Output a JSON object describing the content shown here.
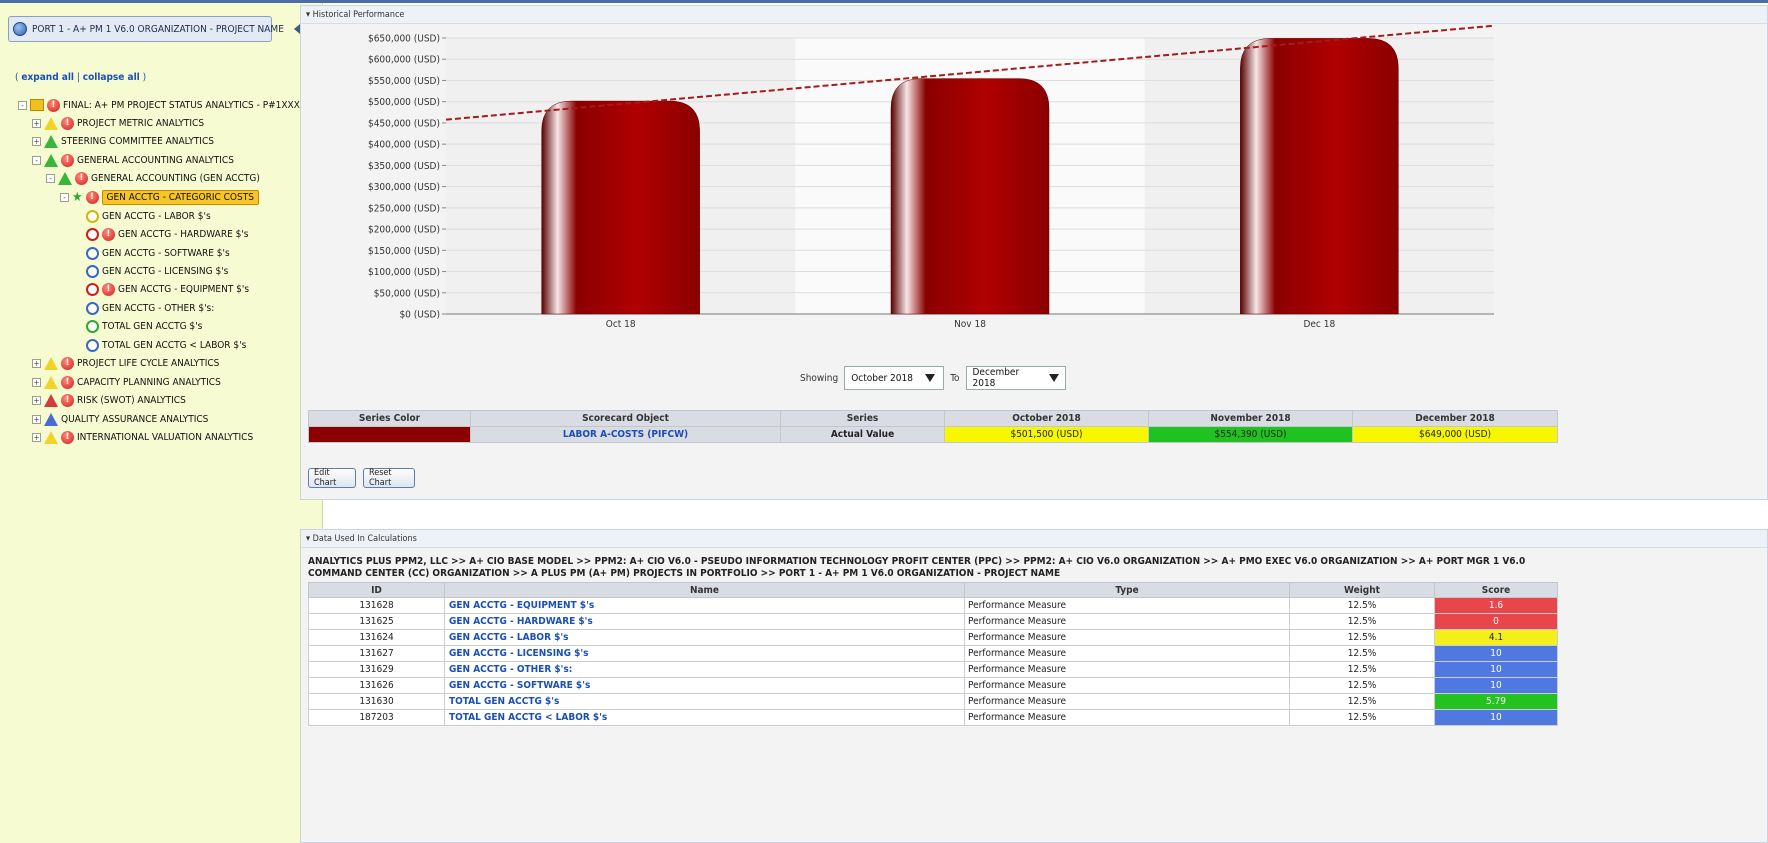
{
  "left_panel": {
    "org_title": "PORT 1 - A+ PM 1 V6.0 ORGANIZATION - PROJECT NAME",
    "expand_all": "expand all",
    "collapse_all": "collapse all",
    "tree": [
      {
        "label": "FINAL: A+ PM PROJECT STATUS ANALYTICS - P#1XXX"
      },
      {
        "label": "PROJECT METRIC ANALYTICS"
      },
      {
        "label": "STEERING COMMITTEE ANALYTICS"
      },
      {
        "label": "GENERAL ACCOUNTING ANALYTICS"
      },
      {
        "label": "GENERAL ACCOUNTING (GEN ACCTG)"
      },
      {
        "label": "GEN ACCTG - CATEGORIC COSTS"
      },
      {
        "label": "GEN ACCTG - LABOR $'s"
      },
      {
        "label": "GEN ACCTG - HARDWARE $'s"
      },
      {
        "label": "GEN ACCTG - SOFTWARE $'s"
      },
      {
        "label": "GEN ACCTG - LICENSING $'s"
      },
      {
        "label": "GEN ACCTG - EQUIPMENT $'s"
      },
      {
        "label": "GEN ACCTG - OTHER $'s:"
      },
      {
        "label": "TOTAL GEN ACCTG $'s"
      },
      {
        "label": "TOTAL GEN ACCTG < LABOR $'s"
      },
      {
        "label": "PROJECT LIFE CYCLE ANALYTICS"
      },
      {
        "label": "CAPACITY PLANNING ANALYTICS"
      },
      {
        "label": "RISK (SWOT) ANALYTICS"
      },
      {
        "label": "QUALITY ASSURANCE ANALYTICS"
      },
      {
        "label": "INTERNATIONAL VALUATION ANALYTICS"
      }
    ]
  },
  "historical": {
    "header": "Historical Performance",
    "showing_label": "Showing",
    "from_value": "October 2018",
    "to_label": "To",
    "to_value": "December 2018",
    "table_headers": [
      "Series Color",
      "Scorecard Object",
      "Series",
      "October 2018",
      "November 2018",
      "December 2018"
    ],
    "row": {
      "scorecard_object": "LABOR A-COSTS (PIFCW)",
      "series": "Actual Value",
      "oct": "$501,500 (USD)",
      "nov": "$554,390 (USD)",
      "dec": "$649,000 (USD)"
    },
    "edit_chart": "Edit Chart",
    "reset_chart": "Reset Chart"
  },
  "chart_data": {
    "type": "bar",
    "categories": [
      "Oct 18",
      "Nov 18",
      "Dec 18"
    ],
    "values": [
      501500,
      554390,
      649000
    ],
    "title": "",
    "xlabel": "",
    "ylabel": "",
    "ylim": [
      0,
      650000
    ],
    "ytick_values": [
      0,
      50000,
      100000,
      150000,
      200000,
      250000,
      300000,
      350000,
      400000,
      450000,
      500000,
      550000,
      600000,
      650000
    ],
    "ytick_labels": [
      "$0 (USD)",
      "$50,000 (USD)",
      "$100,000 (USD)",
      "$150,000 (USD)",
      "$200,000 (USD)",
      "$250,000 (USD)",
      "$300,000 (USD)",
      "$350,000 (USD)",
      "$400,000 (USD)",
      "$450,000 (USD)",
      "$500,000 (USD)",
      "$550,000 (USD)",
      "$600,000 (USD)",
      "$650,000 (USD)"
    ],
    "trendline": {
      "style": "dashed",
      "color": "#a61a1a"
    },
    "bar_color": "#8b0000",
    "grid": true,
    "legend": "none"
  },
  "calc": {
    "header": "Data Used In Calculations",
    "breadcrumb": "ANALYTICS PLUS PPM2, LLC  >>  A+ CIO BASE MODEL  >>  PPM2: A+ CIO V6.0 - PSEUDO INFORMATION TECHNOLOGY PROFIT CENTER (PPC)  >>  PPM2: A+ CIO V6.0 ORGANIZATION  >>  A+ PMO EXEC V6.0 ORGANIZATION  >>  A+ PORT MGR 1 V6.0 COMMAND CENTER (CC) ORGANIZATION  >>  A PLUS PM (A+ PM) PROJECTS IN PORTFOLIO  >>  PORT 1 - A+ PM 1 V6.0 ORGANIZATION - PROJECT NAME",
    "headers": [
      "ID",
      "Name",
      "Type",
      "Weight",
      "Score"
    ],
    "rows": [
      {
        "id": "131628",
        "name": "GEN ACCTG - EQUIPMENT $'s",
        "type": "Performance Measure",
        "weight": "12.5%",
        "score": "1.6",
        "color": "#e8464a"
      },
      {
        "id": "131625",
        "name": "GEN ACCTG - HARDWARE $'s",
        "type": "Performance Measure",
        "weight": "12.5%",
        "score": "0",
        "color": "#e8464a"
      },
      {
        "id": "131624",
        "name": "GEN ACCTG - LABOR $'s",
        "type": "Performance Measure",
        "weight": "12.5%",
        "score": "4.1",
        "color": "#f4ef1a"
      },
      {
        "id": "131627",
        "name": "GEN ACCTG - LICENSING $'s",
        "type": "Performance Measure",
        "weight": "12.5%",
        "score": "10",
        "color": "#4f79e0"
      },
      {
        "id": "131629",
        "name": "GEN ACCTG - OTHER $'s:",
        "type": "Performance Measure",
        "weight": "12.5%",
        "score": "10",
        "color": "#4f79e0"
      },
      {
        "id": "131626",
        "name": "GEN ACCTG - SOFTWARE $'s",
        "type": "Performance Measure",
        "weight": "12.5%",
        "score": "10",
        "color": "#4f79e0"
      },
      {
        "id": "131630",
        "name": "TOTAL GEN ACCTG $'s",
        "type": "Performance Measure",
        "weight": "12.5%",
        "score": "5.79",
        "color": "#23c21f"
      },
      {
        "id": "187203",
        "name": "TOTAL GEN ACCTG < LABOR $'s",
        "type": "Performance Measure",
        "weight": "12.5%",
        "score": "10",
        "color": "#4f79e0"
      }
    ]
  },
  "colors": {
    "oct_cell": "#f7f700",
    "nov_cell": "#1fc21f",
    "dec_cell": "#f7f700",
    "series_swatch": "#8b0000"
  }
}
